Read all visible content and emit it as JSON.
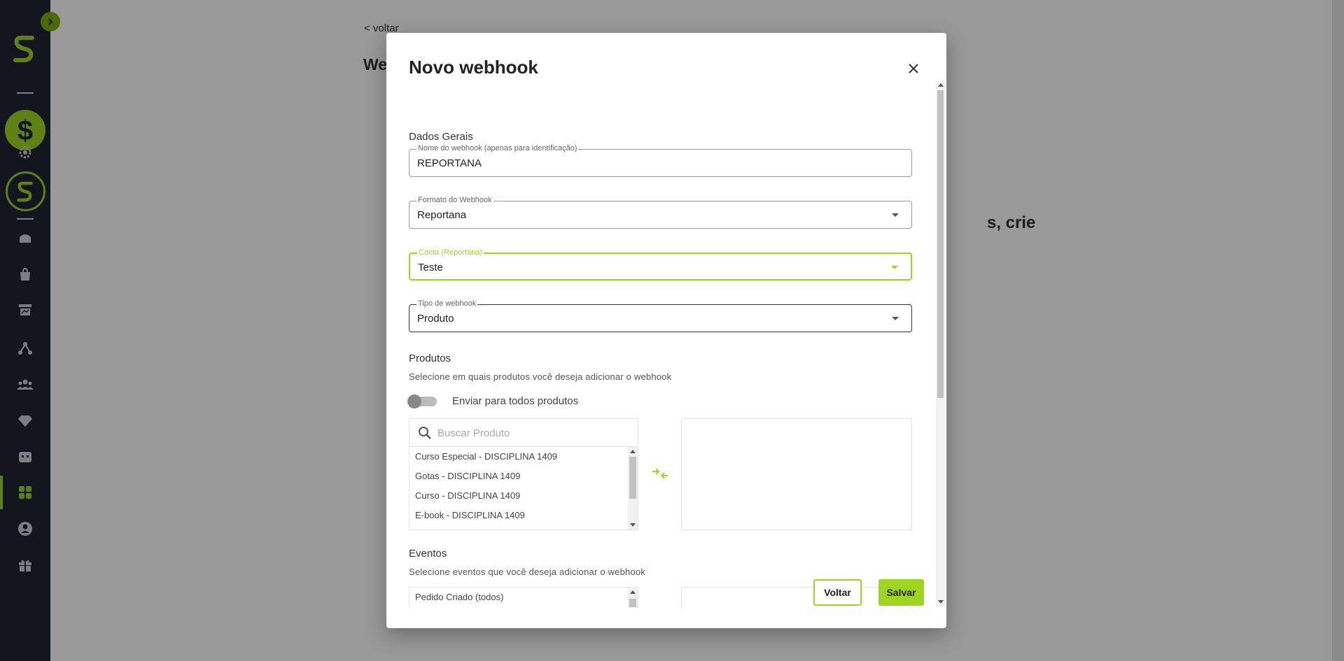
{
  "page": {
    "back_link": "< voltar",
    "title": "Webhook",
    "hint_fragment": "s, crie"
  },
  "sidebar": {
    "items": [
      {
        "icon": "home-icon"
      },
      {
        "icon": "bag-icon"
      },
      {
        "icon": "sales-icon"
      },
      {
        "icon": "affiliates-icon"
      },
      {
        "icon": "users-icon"
      },
      {
        "icon": "diamond-icon"
      },
      {
        "icon": "calendar-icon"
      },
      {
        "icon": "apps-icon",
        "active": true
      },
      {
        "icon": "profile-icon"
      },
      {
        "icon": "gift-icon"
      }
    ]
  },
  "modal": {
    "title": "Novo webhook",
    "general_section": "Dados Gerais",
    "fields": {
      "name": {
        "label": "Nome do webhook (apenas para identificação)",
        "value": "REPORTANA"
      },
      "format": {
        "label": "Formato do Webhook",
        "value": "Reportana"
      },
      "account": {
        "label": "Conta (Reportana)",
        "value": "Teste"
      },
      "type": {
        "label": "Tipo de webhook",
        "value": "Produto"
      }
    },
    "products": {
      "title": "Produtos",
      "description": "Selecione em quais produtos você deseja adicionar o webhook",
      "toggle_label": "Enviar para todos produtos",
      "search_placeholder": "Buscar Produto",
      "items": [
        "Curso Especial - DISCIPLINA 1409",
        "Gotas - DISCIPLINA 1409",
        "Curso - DISCIPLINA 1409",
        "E-book - DISCIPLINA 1409"
      ]
    },
    "events": {
      "title": "Eventos",
      "description": "Selecione eventos que você deseja adicionar o webhook",
      "items": [
        "Pedido Criado (todos)"
      ]
    },
    "buttons": {
      "back": "Voltar",
      "save": "Salvar"
    }
  },
  "colors": {
    "accent": "#9fd520",
    "sidebar_bg": "#1e2433"
  }
}
